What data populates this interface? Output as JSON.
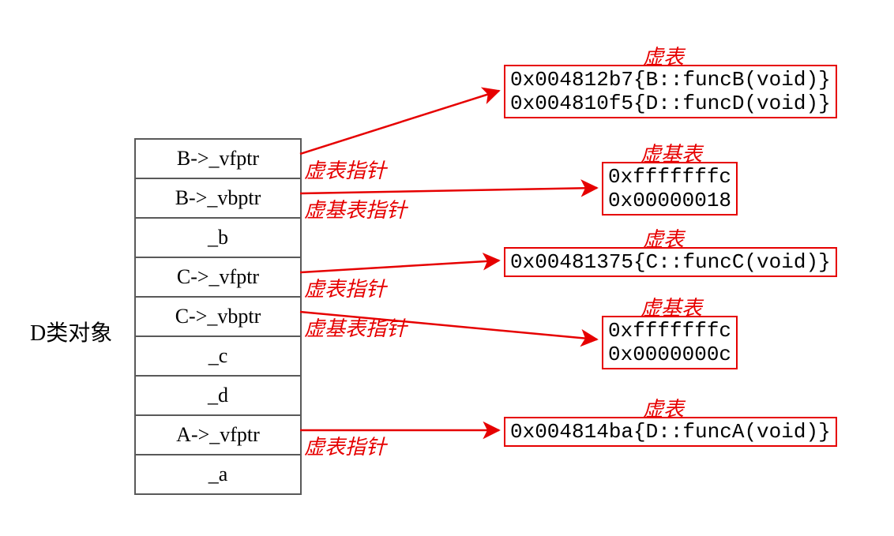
{
  "object": {
    "label": "D类对象",
    "rows": [
      "B->_vfptr",
      "B->_vbptr",
      "_b",
      "C->_vfptr",
      "C->_vbptr",
      "_c",
      "_d",
      "A->_vfptr",
      "_a"
    ]
  },
  "pointer_labels": {
    "row0": "虚表指针",
    "row1": "虚基表指针",
    "row3": "虚表指针",
    "row4": "虚基表指针",
    "row7": "虚表指针"
  },
  "vtables": {
    "vt_B": {
      "title": "虚表",
      "lines": [
        "0x004812b7{B::funcB(void)}",
        "0x004810f5{D::funcD(void)}"
      ]
    },
    "vbt_B": {
      "title": "虚基表",
      "lines": [
        "0xfffffffc",
        "0x00000018"
      ]
    },
    "vt_C": {
      "title": "虚表",
      "lines": [
        "0x00481375{C::funcC(void)}"
      ]
    },
    "vbt_C": {
      "title": "虚基表",
      "lines": [
        "0xfffffffc",
        "0x0000000c"
      ]
    },
    "vt_A": {
      "title": "虚表",
      "lines": [
        "0x004814ba{D::funcA(void)}"
      ]
    }
  },
  "chart_data": {
    "type": "diagram",
    "description": "Memory layout and virtual-table / virtual-base-table pointer diagram for a C++ class D object under diamond virtual inheritance",
    "left_label": "D类对象",
    "object_rows": [
      {
        "index": 0,
        "field": "B->_vfptr",
        "annotation": "虚表指针",
        "points_to": "vt_B"
      },
      {
        "index": 1,
        "field": "B->_vbptr",
        "annotation": "虚基表指针",
        "points_to": "vbt_B"
      },
      {
        "index": 2,
        "field": "_b"
      },
      {
        "index": 3,
        "field": "C->_vfptr",
        "annotation": "虚表指针",
        "points_to": "vt_C"
      },
      {
        "index": 4,
        "field": "C->_vbptr",
        "annotation": "虚基表指针",
        "points_to": "vbt_C"
      },
      {
        "index": 5,
        "field": "_c"
      },
      {
        "index": 6,
        "field": "_d"
      },
      {
        "index": 7,
        "field": "A->_vfptr",
        "annotation": "虚表指针",
        "points_to": "vt_A"
      },
      {
        "index": 8,
        "field": "_a"
      }
    ],
    "tables": {
      "vt_B": {
        "title": "虚表",
        "entries": [
          "0x004812b7{B::funcB(void)}",
          "0x004810f5{D::funcD(void)}"
        ]
      },
      "vbt_B": {
        "title": "虚基表",
        "entries": [
          "0xfffffffc",
          "0x00000018"
        ]
      },
      "vt_C": {
        "title": "虚表",
        "entries": [
          "0x00481375{C::funcC(void)}"
        ]
      },
      "vbt_C": {
        "title": "虚基表",
        "entries": [
          "0xfffffffc",
          "0x0000000c"
        ]
      },
      "vt_A": {
        "title": "虚表",
        "entries": [
          "0x004814ba{D::funcA(void)}"
        ]
      }
    }
  }
}
